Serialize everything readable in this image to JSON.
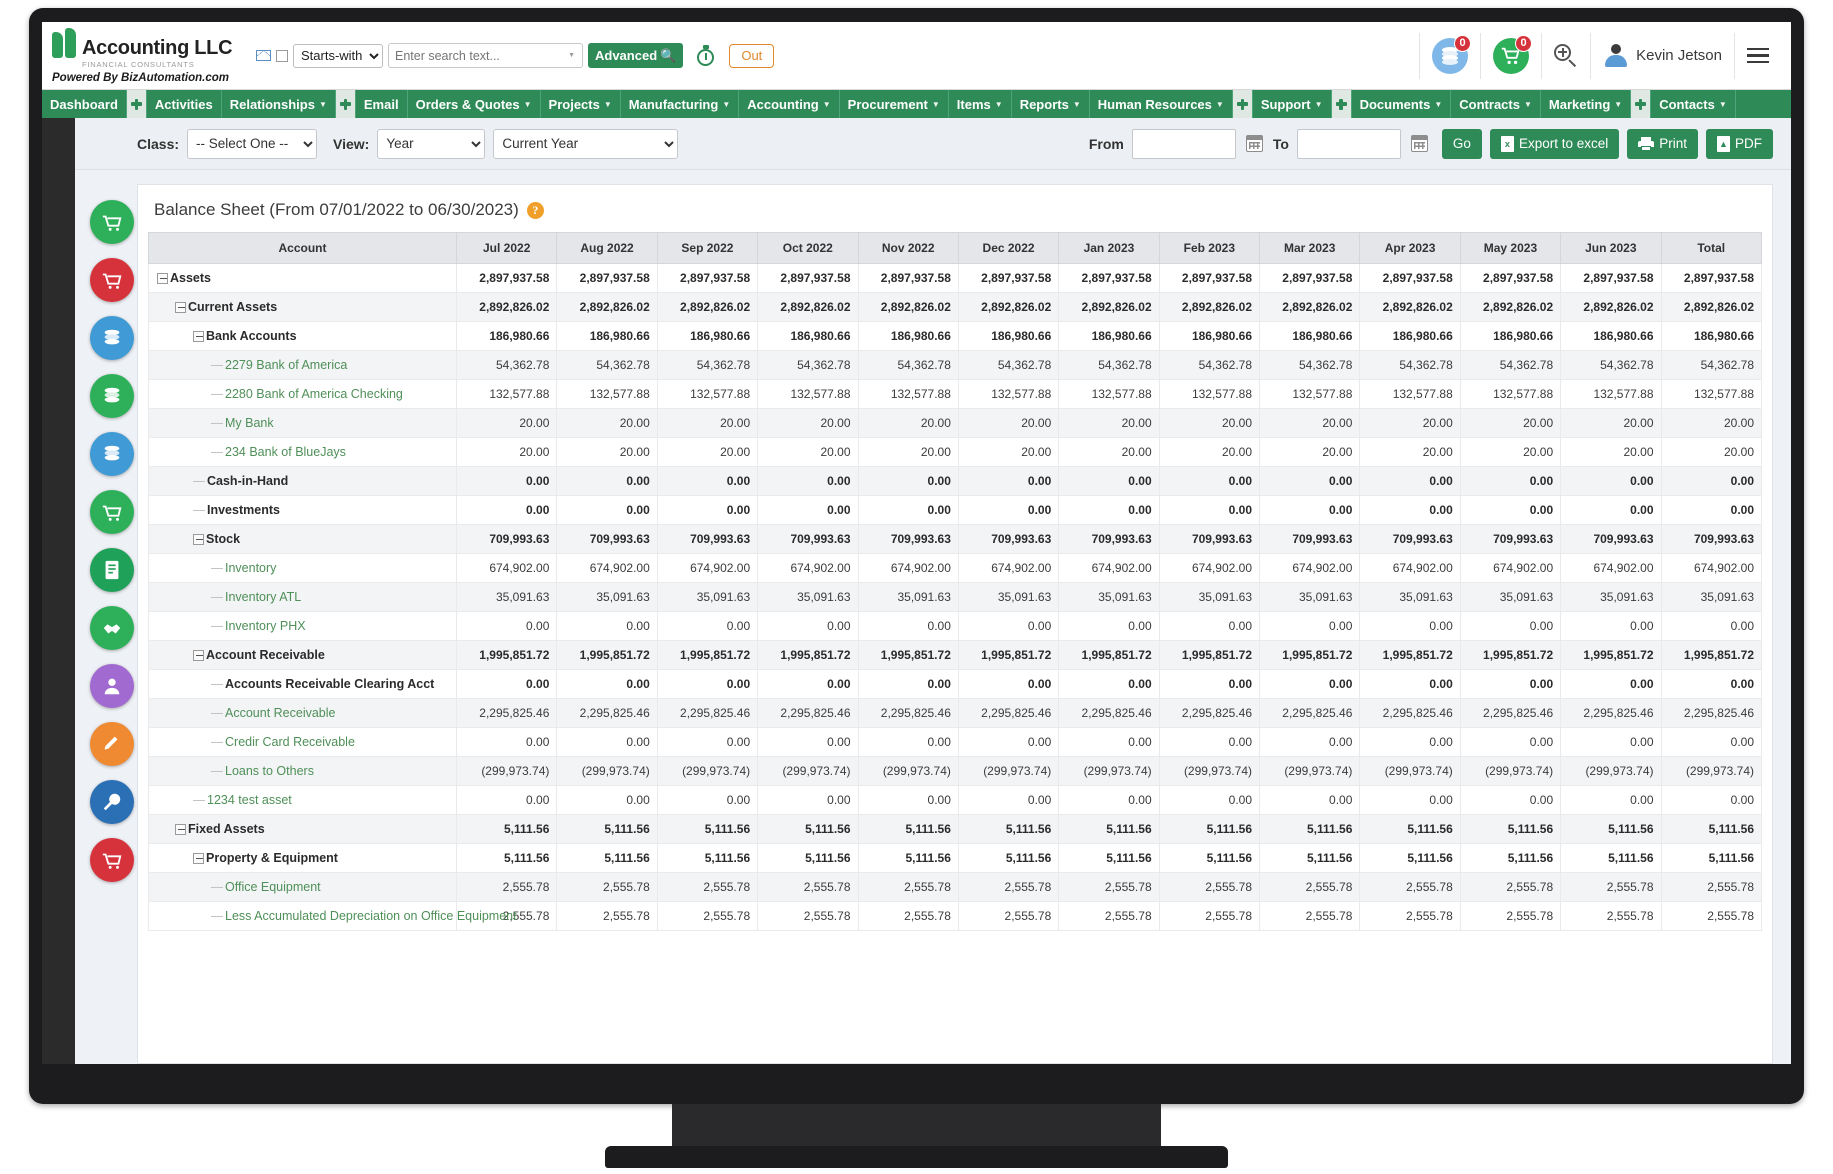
{
  "header": {
    "logo_name": "Accounting LLC",
    "logo_sub": "FINANCIAL CONSULTANTS",
    "powered_by": "Powered By BizAutomation.com",
    "search_mode": "Starts-with",
    "search_placeholder": "Enter search text...",
    "search_value": "",
    "advanced_label": "Advanced",
    "out_label": "Out",
    "stack_badge": "0",
    "cart_badge": "0",
    "user_name": "Kevin Jetson"
  },
  "nav": {
    "items": [
      {
        "label": "Dashboard",
        "caret": false,
        "plus_after": true
      },
      {
        "label": "Activities",
        "caret": false,
        "plus_after": false
      },
      {
        "label": "Relationships",
        "caret": true,
        "plus_after": true
      },
      {
        "label": "Email",
        "caret": false,
        "plus_after": false
      },
      {
        "label": "Orders & Quotes",
        "caret": true,
        "plus_after": false
      },
      {
        "label": "Projects",
        "caret": true,
        "plus_after": false
      },
      {
        "label": "Manufacturing",
        "caret": true,
        "plus_after": false
      },
      {
        "label": "Accounting",
        "caret": true,
        "plus_after": false
      },
      {
        "label": "Procurement",
        "caret": true,
        "plus_after": false
      },
      {
        "label": "Items",
        "caret": true,
        "plus_after": false
      },
      {
        "label": "Reports",
        "caret": true,
        "plus_after": false
      },
      {
        "label": "Human Resources",
        "caret": true,
        "plus_after": true
      },
      {
        "label": "Support",
        "caret": true,
        "plus_after": true
      },
      {
        "label": "Documents",
        "caret": true,
        "plus_after": false
      },
      {
        "label": "Contracts",
        "caret": true,
        "plus_after": false
      },
      {
        "label": "Marketing",
        "caret": true,
        "plus_after": true
      },
      {
        "label": "Contacts",
        "caret": true,
        "plus_after": false
      }
    ]
  },
  "quick_icons": [
    {
      "name": "invoice-green-icon",
      "glyph": "☷",
      "color": "#2eb05a"
    },
    {
      "name": "cart-red-icon",
      "glyph": "Ὥ2",
      "color": "#d6323b"
    },
    {
      "name": "stack-blue-icon",
      "glyph": "☰",
      "color": "#3f9ad6"
    },
    {
      "name": "stack-green-icon",
      "glyph": "☰",
      "color": "#2eb05a"
    },
    {
      "name": "stack-blue2-icon",
      "glyph": "☰",
      "color": "#3f9ad6"
    },
    {
      "name": "cart-green-icon",
      "glyph": "☷",
      "color": "#2eb05a"
    },
    {
      "name": "document-green-icon",
      "glyph": "☷",
      "color": "#1fa15a"
    },
    {
      "name": "handshake-green-icon",
      "glyph": "☷",
      "color": "#2eb05a"
    },
    {
      "name": "person-purple-icon",
      "glyph": "☷",
      "color": "#a06ad1"
    },
    {
      "name": "pencil-orange-icon",
      "glyph": "☷",
      "color": "#ef8a33"
    },
    {
      "name": "tools-blue-icon",
      "glyph": "☷",
      "color": "#2b6fb5"
    },
    {
      "name": "cart-red2-icon",
      "glyph": "☷",
      "color": "#d6323b"
    }
  ],
  "filterbar": {
    "class_label": "Class:",
    "class_value": "-- Select One --",
    "view_label": "View:",
    "view_value": "Year",
    "period_value": "Current Year",
    "from_label": "From",
    "from_value": "",
    "to_label": "To",
    "to_value": "",
    "go_label": "Go",
    "export_label": "Export to excel",
    "print_label": "Print",
    "pdf_label": "PDF"
  },
  "report": {
    "title": "Balance Sheet (From 07/01/2022 to 06/30/2023)",
    "info_tooltip": "?",
    "columns": [
      "Account",
      "Jul 2022",
      "Aug 2022",
      "Sep 2022",
      "Oct 2022",
      "Nov 2022",
      "Dec 2022",
      "Jan 2023",
      "Feb 2023",
      "Mar 2023",
      "Apr 2023",
      "May 2023",
      "Jun 2023",
      "Total"
    ],
    "rows": [
      {
        "label": "Assets",
        "level": 0,
        "expandable": true,
        "type": "group",
        "values": [
          "2,897,937.58",
          "2,897,937.58",
          "2,897,937.58",
          "2,897,937.58",
          "2,897,937.58",
          "2,897,937.58",
          "2,897,937.58",
          "2,897,937.58",
          "2,897,937.58",
          "2,897,937.58",
          "2,897,937.58",
          "2,897,937.58",
          "2,897,937.58"
        ]
      },
      {
        "label": "Current Assets",
        "level": 1,
        "expandable": true,
        "type": "group",
        "values": [
          "2,892,826.02",
          "2,892,826.02",
          "2,892,826.02",
          "2,892,826.02",
          "2,892,826.02",
          "2,892,826.02",
          "2,892,826.02",
          "2,892,826.02",
          "2,892,826.02",
          "2,892,826.02",
          "2,892,826.02",
          "2,892,826.02",
          "2,892,826.02"
        ]
      },
      {
        "label": "Bank Accounts",
        "level": 2,
        "expandable": true,
        "type": "group",
        "values": [
          "186,980.66",
          "186,980.66",
          "186,980.66",
          "186,980.66",
          "186,980.66",
          "186,980.66",
          "186,980.66",
          "186,980.66",
          "186,980.66",
          "186,980.66",
          "186,980.66",
          "186,980.66",
          "186,980.66"
        ]
      },
      {
        "label": "2279 Bank of America",
        "level": 3,
        "expandable": false,
        "type": "leaf",
        "values": [
          "54,362.78",
          "54,362.78",
          "54,362.78",
          "54,362.78",
          "54,362.78",
          "54,362.78",
          "54,362.78",
          "54,362.78",
          "54,362.78",
          "54,362.78",
          "54,362.78",
          "54,362.78",
          "54,362.78"
        ]
      },
      {
        "label": "2280 Bank of America Checking",
        "level": 3,
        "expandable": false,
        "type": "leaf",
        "values": [
          "132,577.88",
          "132,577.88",
          "132,577.88",
          "132,577.88",
          "132,577.88",
          "132,577.88",
          "132,577.88",
          "132,577.88",
          "132,577.88",
          "132,577.88",
          "132,577.88",
          "132,577.88",
          "132,577.88"
        ]
      },
      {
        "label": "My Bank",
        "level": 3,
        "expandable": false,
        "type": "leaf",
        "values": [
          "20.00",
          "20.00",
          "20.00",
          "20.00",
          "20.00",
          "20.00",
          "20.00",
          "20.00",
          "20.00",
          "20.00",
          "20.00",
          "20.00",
          "20.00"
        ]
      },
      {
        "label": "234 Bank of BlueJays",
        "level": 3,
        "expandable": false,
        "type": "leaf",
        "values": [
          "20.00",
          "20.00",
          "20.00",
          "20.00",
          "20.00",
          "20.00",
          "20.00",
          "20.00",
          "20.00",
          "20.00",
          "20.00",
          "20.00",
          "20.00"
        ]
      },
      {
        "label": "Cash-in-Hand",
        "level": 2,
        "expandable": false,
        "type": "group",
        "values": [
          "0.00",
          "0.00",
          "0.00",
          "0.00",
          "0.00",
          "0.00",
          "0.00",
          "0.00",
          "0.00",
          "0.00",
          "0.00",
          "0.00",
          "0.00"
        ]
      },
      {
        "label": "Investments",
        "level": 2,
        "expandable": false,
        "type": "group",
        "values": [
          "0.00",
          "0.00",
          "0.00",
          "0.00",
          "0.00",
          "0.00",
          "0.00",
          "0.00",
          "0.00",
          "0.00",
          "0.00",
          "0.00",
          "0.00"
        ]
      },
      {
        "label": "Stock",
        "level": 2,
        "expandable": true,
        "type": "group",
        "values": [
          "709,993.63",
          "709,993.63",
          "709,993.63",
          "709,993.63",
          "709,993.63",
          "709,993.63",
          "709,993.63",
          "709,993.63",
          "709,993.63",
          "709,993.63",
          "709,993.63",
          "709,993.63",
          "709,993.63"
        ]
      },
      {
        "label": "Inventory",
        "level": 3,
        "expandable": false,
        "type": "leaf",
        "values": [
          "674,902.00",
          "674,902.00",
          "674,902.00",
          "674,902.00",
          "674,902.00",
          "674,902.00",
          "674,902.00",
          "674,902.00",
          "674,902.00",
          "674,902.00",
          "674,902.00",
          "674,902.00",
          "674,902.00"
        ]
      },
      {
        "label": "Inventory ATL",
        "level": 3,
        "expandable": false,
        "type": "leaf",
        "values": [
          "35,091.63",
          "35,091.63",
          "35,091.63",
          "35,091.63",
          "35,091.63",
          "35,091.63",
          "35,091.63",
          "35,091.63",
          "35,091.63",
          "35,091.63",
          "35,091.63",
          "35,091.63",
          "35,091.63"
        ]
      },
      {
        "label": "Inventory PHX",
        "level": 3,
        "expandable": false,
        "type": "leaf",
        "values": [
          "0.00",
          "0.00",
          "0.00",
          "0.00",
          "0.00",
          "0.00",
          "0.00",
          "0.00",
          "0.00",
          "0.00",
          "0.00",
          "0.00",
          "0.00"
        ]
      },
      {
        "label": "Account Receivable",
        "level": 2,
        "expandable": true,
        "type": "group",
        "values": [
          "1,995,851.72",
          "1,995,851.72",
          "1,995,851.72",
          "1,995,851.72",
          "1,995,851.72",
          "1,995,851.72",
          "1,995,851.72",
          "1,995,851.72",
          "1,995,851.72",
          "1,995,851.72",
          "1,995,851.72",
          "1,995,851.72",
          "1,995,851.72"
        ]
      },
      {
        "label": "Accounts Receivable Clearing Acct",
        "level": 3,
        "expandable": false,
        "type": "group",
        "values": [
          "0.00",
          "0.00",
          "0.00",
          "0.00",
          "0.00",
          "0.00",
          "0.00",
          "0.00",
          "0.00",
          "0.00",
          "0.00",
          "0.00",
          "0.00"
        ]
      },
      {
        "label": "Account Receivable",
        "level": 3,
        "expandable": false,
        "type": "leaf",
        "values": [
          "2,295,825.46",
          "2,295,825.46",
          "2,295,825.46",
          "2,295,825.46",
          "2,295,825.46",
          "2,295,825.46",
          "2,295,825.46",
          "2,295,825.46",
          "2,295,825.46",
          "2,295,825.46",
          "2,295,825.46",
          "2,295,825.46",
          "2,295,825.46"
        ]
      },
      {
        "label": "Credir Card Receivable",
        "level": 3,
        "expandable": false,
        "type": "leaf",
        "values": [
          "0.00",
          "0.00",
          "0.00",
          "0.00",
          "0.00",
          "0.00",
          "0.00",
          "0.00",
          "0.00",
          "0.00",
          "0.00",
          "0.00",
          "0.00"
        ]
      },
      {
        "label": "Loans to Others",
        "level": 3,
        "expandable": false,
        "type": "leaf",
        "values": [
          "(299,973.74)",
          "(299,973.74)",
          "(299,973.74)",
          "(299,973.74)",
          "(299,973.74)",
          "(299,973.74)",
          "(299,973.74)",
          "(299,973.74)",
          "(299,973.74)",
          "(299,973.74)",
          "(299,973.74)",
          "(299,973.74)",
          "(299,973.74)"
        ]
      },
      {
        "label": "1234 test asset",
        "level": 2,
        "expandable": false,
        "type": "leaf",
        "values": [
          "0.00",
          "0.00",
          "0.00",
          "0.00",
          "0.00",
          "0.00",
          "0.00",
          "0.00",
          "0.00",
          "0.00",
          "0.00",
          "0.00",
          "0.00"
        ]
      },
      {
        "label": "Fixed Assets",
        "level": 1,
        "expandable": true,
        "type": "group",
        "values": [
          "5,111.56",
          "5,111.56",
          "5,111.56",
          "5,111.56",
          "5,111.56",
          "5,111.56",
          "5,111.56",
          "5,111.56",
          "5,111.56",
          "5,111.56",
          "5,111.56",
          "5,111.56",
          "5,111.56"
        ]
      },
      {
        "label": "Property & Equipment",
        "level": 2,
        "expandable": true,
        "type": "group",
        "values": [
          "5,111.56",
          "5,111.56",
          "5,111.56",
          "5,111.56",
          "5,111.56",
          "5,111.56",
          "5,111.56",
          "5,111.56",
          "5,111.56",
          "5,111.56",
          "5,111.56",
          "5,111.56",
          "5,111.56"
        ]
      },
      {
        "label": "Office Equipment",
        "level": 3,
        "expandable": false,
        "type": "leaf",
        "values": [
          "2,555.78",
          "2,555.78",
          "2,555.78",
          "2,555.78",
          "2,555.78",
          "2,555.78",
          "2,555.78",
          "2,555.78",
          "2,555.78",
          "2,555.78",
          "2,555.78",
          "2,555.78",
          "2,555.78"
        ]
      },
      {
        "label": "Less Accumulated Depreciation on Office Equipment",
        "level": 3,
        "expandable": false,
        "type": "leaf",
        "values": [
          "2,555.78",
          "2,555.78",
          "2,555.78",
          "2,555.78",
          "2,555.78",
          "2,555.78",
          "2,555.78",
          "2,555.78",
          "2,555.78",
          "2,555.78",
          "2,555.78",
          "2,555.78",
          "2,555.78"
        ]
      }
    ]
  },
  "colors": {
    "brand_green": "#2e8b57",
    "accent_orange": "#e08a2e",
    "link_green": "#4f8f58",
    "badge_red": "#d6323b"
  }
}
